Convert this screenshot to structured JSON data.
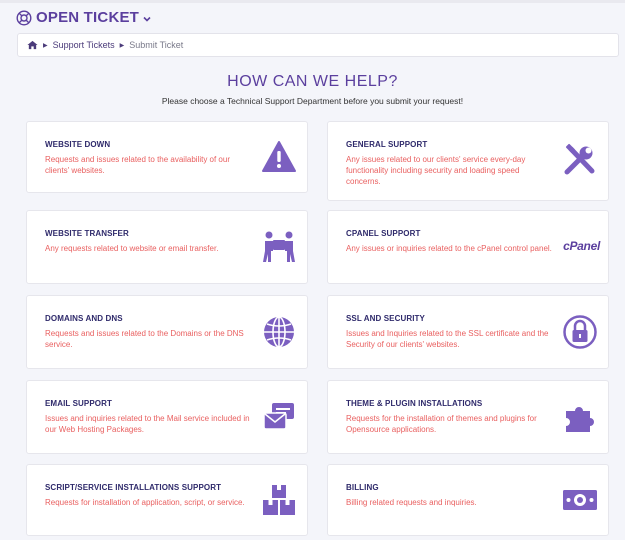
{
  "header": {
    "title": "OPEN TICKET"
  },
  "breadcrumb": {
    "items": [
      "Support Tickets",
      "Submit Ticket"
    ]
  },
  "intro": {
    "heading": "HOW CAN WE HELP?",
    "subheading": "Please choose a Technical Support Department before you submit your request!"
  },
  "colors": {
    "brand": "#5b3f9e",
    "title": "#2f2a6b",
    "description": "#e96060",
    "icon": "#7b5fc0"
  },
  "departments": [
    {
      "title": "WEBSITE DOWN",
      "description": "Requests and issues related to the availability of our clients' websites.",
      "icon": "warning-icon"
    },
    {
      "title": "GENERAL SUPPORT",
      "description": "Any issues related to our clients' service every-day functionality including security and loading speed concerns.",
      "icon": "tools-icon"
    },
    {
      "title": "WEBSITE TRANSFER",
      "description": "Any requests related to website or email transfer.",
      "icon": "movers-icon"
    },
    {
      "title": "CPANEL SUPPORT",
      "description": "Any issues or inquiries related to the cPanel control panel.",
      "icon": "cpanel-logo",
      "logo_text": "cPanel"
    },
    {
      "title": "DOMAINS AND DNS",
      "description": "Requests and issues related to the Domains or the DNS service.",
      "icon": "globe-icon"
    },
    {
      "title": "SSL AND SECURITY",
      "description": "Issues and Inquiries related to the SSL certificate and the Security of our clients' websites.",
      "icon": "lock-icon"
    },
    {
      "title": "EMAIL SUPPORT",
      "description": "Issues and inquiries related to the Mail service included in our Web Hosting Packages.",
      "icon": "envelopes-icon"
    },
    {
      "title": "THEME & PLUGIN INSTALLATIONS",
      "description": "Requests for the installation of themes and plugins for Opensource applications.",
      "icon": "puzzle-icon"
    },
    {
      "title": "SCRIPT/SERVICE INSTALLATIONS SUPPORT",
      "description": "Requests for installation of application, script, or service.",
      "icon": "boxes-icon"
    },
    {
      "title": "BILLING",
      "description": "Billing related requests and inquiries.",
      "icon": "money-icon"
    }
  ]
}
